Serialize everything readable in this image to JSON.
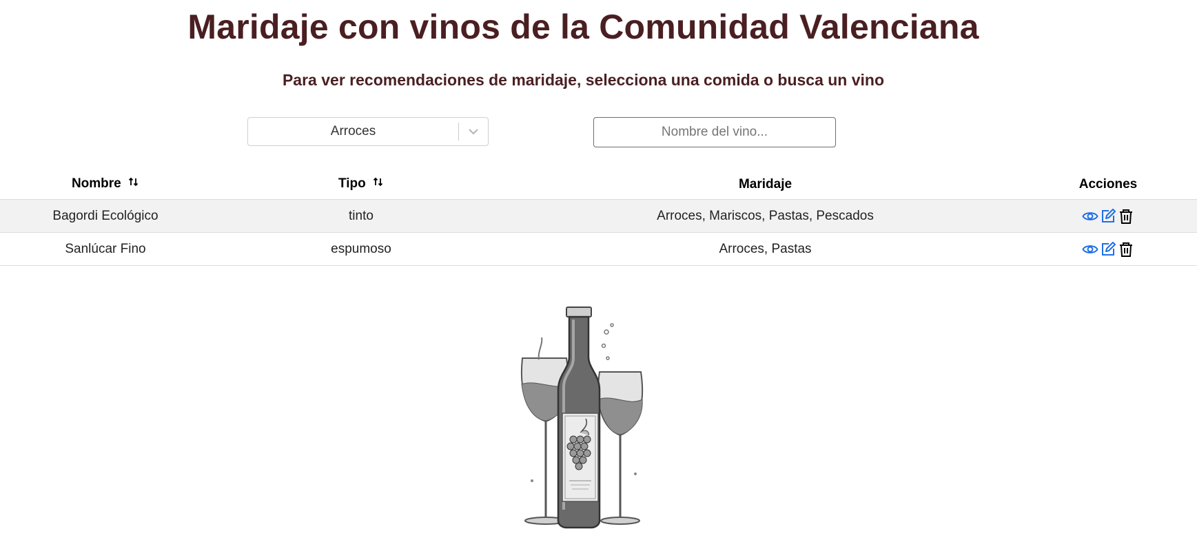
{
  "header": {
    "title": "Maridaje con vinos de la Comunidad Valenciana",
    "subtitle": "Para ver recomendaciones de maridaje, selecciona una comida o busca un vino"
  },
  "filters": {
    "food_select": {
      "selected": "Arroces"
    },
    "wine_search": {
      "placeholder": "Nombre del vino...",
      "value": ""
    }
  },
  "table": {
    "columns": [
      "Nombre",
      "Tipo",
      "Maridaje",
      "Acciones"
    ],
    "rows": [
      {
        "nombre": "Bagordi Ecológico",
        "tipo": "tinto",
        "maridaje": "Arroces, Mariscos, Pastas, Pescados"
      },
      {
        "nombre": "Sanlúcar Fino",
        "tipo": "espumoso",
        "maridaje": "Arroces, Pastas"
      }
    ],
    "actions": [
      "eye-icon",
      "edit-icon",
      "trash-icon"
    ]
  },
  "colors": {
    "title": "#4a1f22",
    "action_blue": "#1f6fe5",
    "row_stripe": "#f2f2f2"
  }
}
